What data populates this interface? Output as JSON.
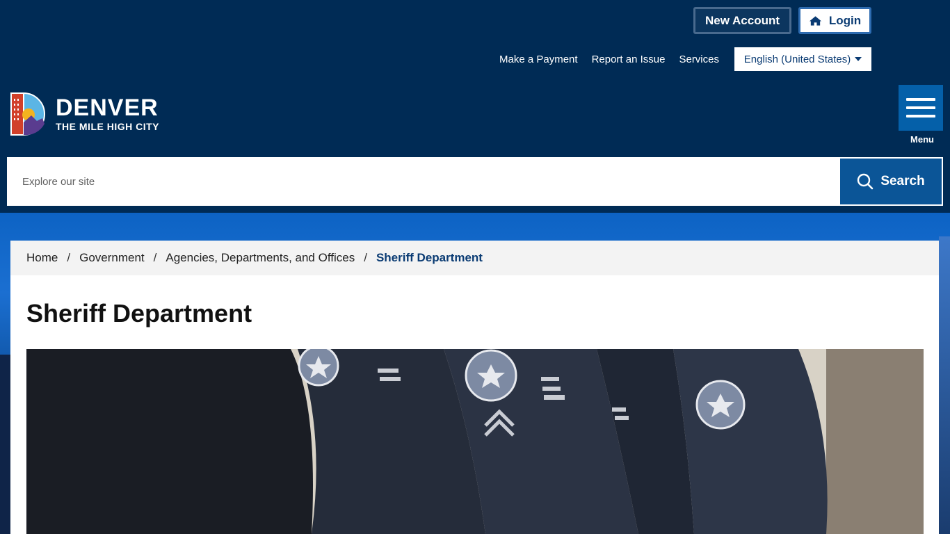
{
  "header": {
    "new_account": "New Account",
    "login": "Login",
    "utility_links": [
      "Make a Payment",
      "Report an Issue",
      "Services"
    ],
    "language": "English (United States)",
    "logo_title": "DENVER",
    "logo_subtitle": "THE MILE HIGH CITY",
    "menu_label": "Menu"
  },
  "search": {
    "placeholder": "Explore our site",
    "button": "Search"
  },
  "breadcrumb": {
    "items": [
      "Home",
      "Government",
      "Agencies, Departments, and Offices"
    ],
    "current": "Sheriff Department"
  },
  "page": {
    "title": "Sheriff Department"
  },
  "colors": {
    "header_bg": "#002b55",
    "accent": "#0b5597",
    "link": "#0a3b73"
  }
}
